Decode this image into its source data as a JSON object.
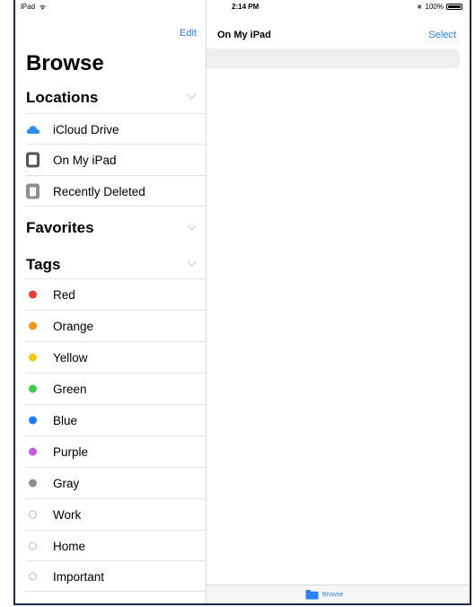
{
  "status": {
    "device": "iPad",
    "time": "2:14 PM",
    "battery": "100%"
  },
  "sidebar": {
    "edit_label": "Edit",
    "title": "Browse",
    "locations_header": "Locations",
    "locations": [
      {
        "label": "iCloud Drive",
        "icon": "icloud-icon"
      },
      {
        "label": "On My iPad",
        "icon": "ipad-icon"
      },
      {
        "label": "Recently Deleted",
        "icon": "trash-icon"
      }
    ],
    "favorites_header": "Favorites",
    "tags_header": "Tags",
    "tags": [
      {
        "label": "Red",
        "color": "#f03b30"
      },
      {
        "label": "Orange",
        "color": "#f7950a"
      },
      {
        "label": "Yellow",
        "color": "#f6c812"
      },
      {
        "label": "Green",
        "color": "#3fcb4c"
      },
      {
        "label": "Blue",
        "color": "#1a7ef7"
      },
      {
        "label": "Purple",
        "color": "#c45bde"
      },
      {
        "label": "Gray",
        "color": "#8e8e93"
      },
      {
        "label": "Work",
        "color": ""
      },
      {
        "label": "Home",
        "color": ""
      },
      {
        "label": "Important",
        "color": ""
      }
    ]
  },
  "main": {
    "title": "On My iPad",
    "select_label": "Select"
  },
  "tabbar": {
    "browse_label": "Browse"
  },
  "colors": {
    "accent": "#2a7ef6"
  }
}
